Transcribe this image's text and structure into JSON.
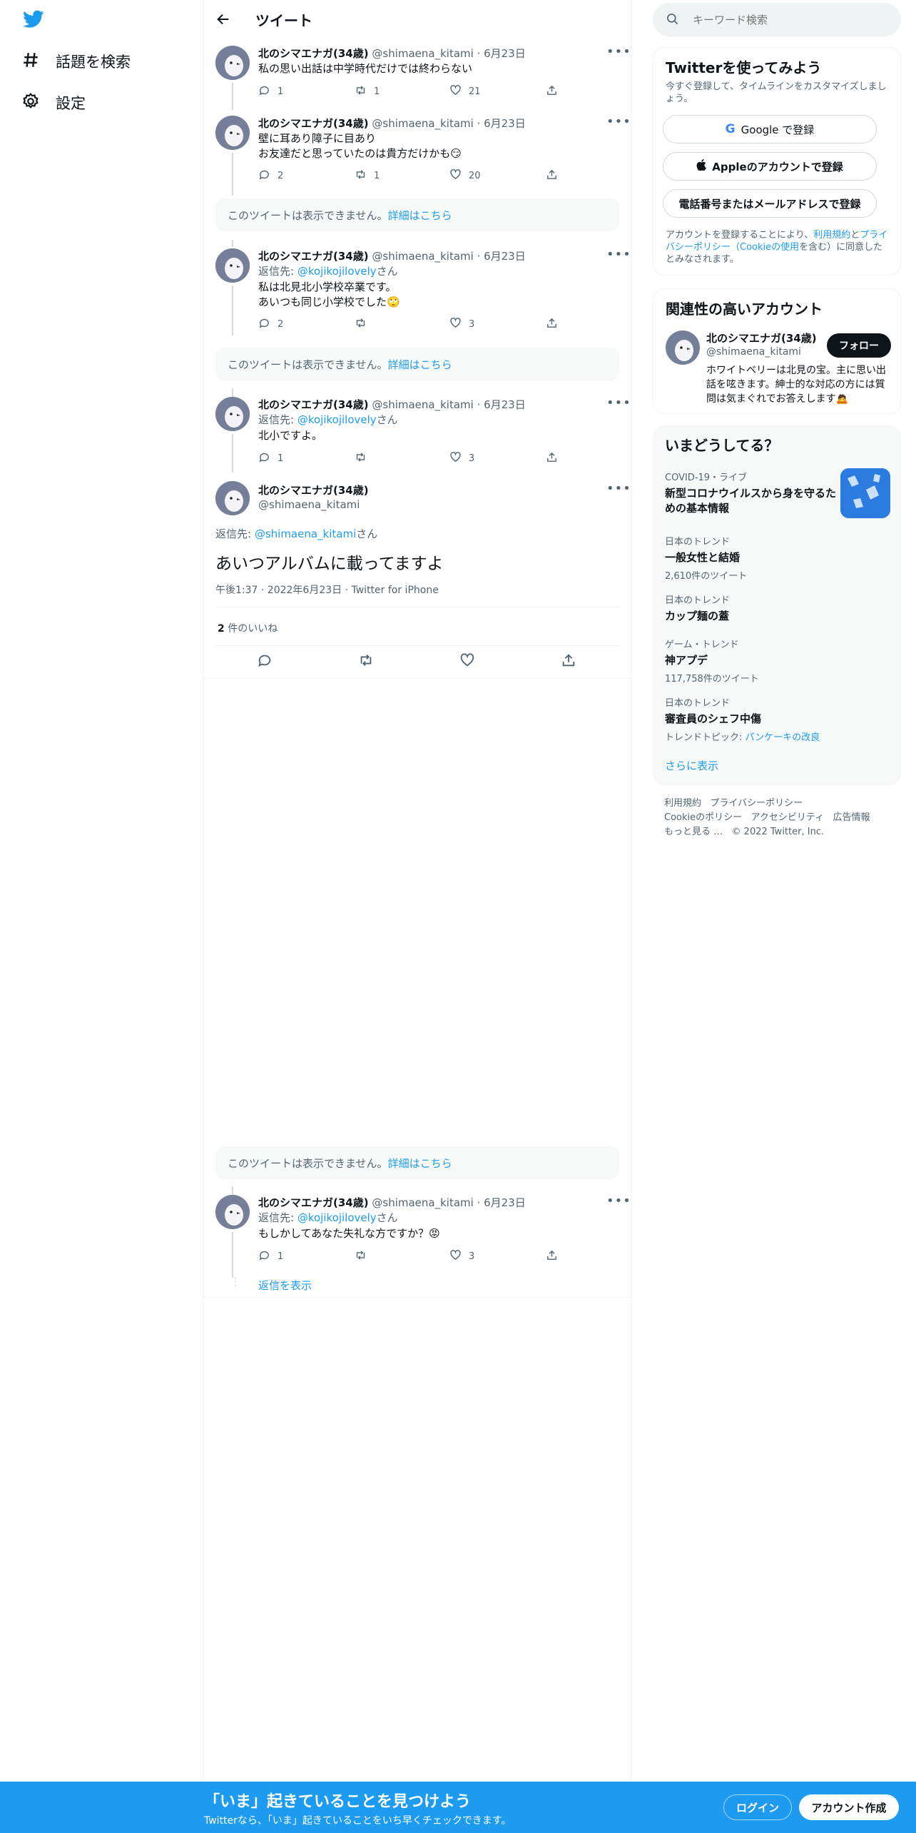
{
  "nav": {
    "explore_label": "話題を検索",
    "settings_label": "設定"
  },
  "header": {
    "title": "ツイート"
  },
  "user": {
    "name": "北のシマエナガ(34歳)",
    "handle": "@shimaena_kitami"
  },
  "tweets": [
    {
      "meta": "@shimaena_kitami · 6月23日",
      "text": "私の思い出話は中学時代だけでは終わらない",
      "replies": "1",
      "retweets": "1",
      "likes": "21"
    },
    {
      "meta": "@shimaena_kitami · 6月23日",
      "text": "壁に耳あり障子に目あり\nお友達だと思っていたのは貴方だけかも😏",
      "replies": "2",
      "retweets": "1",
      "likes": "20"
    },
    {
      "meta": "@shimaena_kitami · 6月23日",
      "reply_prefix": "返信先: ",
      "reply_to": "@kojikojilovely",
      "reply_suffix": "さん",
      "text": "私は北見北小学校卒業です。\nあいつも同じ小学校でした🙄",
      "replies": "2",
      "retweets": "",
      "likes": "3"
    },
    {
      "meta": "@shimaena_kitami · 6月23日",
      "reply_prefix": "返信先: ",
      "reply_to": "@kojikojilovely",
      "reply_suffix": "さん",
      "text": "北小ですよ。",
      "replies": "1",
      "retweets": "",
      "likes": "3"
    },
    {
      "meta": "@shimaena_kitami · 6月23日",
      "reply_prefix": "返信先: ",
      "reply_to": "@kojikojilovely",
      "reply_suffix": "さん",
      "text": "もしかしてあなた失礼な方ですか？😡",
      "replies": "1",
      "retweets": "",
      "likes": "3"
    }
  ],
  "hidden_notice": {
    "text": "このツイートは表示できません。",
    "link": "詳細はこちら"
  },
  "focused": {
    "reply_prefix": "返信先: ",
    "reply_to": "@shimaena_kitami",
    "reply_suffix": "さん",
    "text": "あいつアルバムに載ってますよ",
    "timestamp": "午後1:37 · 2022年6月23日 · Twitter for iPhone",
    "likes_count": "2",
    "likes_label": "件のいいね"
  },
  "show_replies": "返信を表示",
  "search": {
    "placeholder": "キーワード検索"
  },
  "signup": {
    "title": "Twitterを使ってみよう",
    "subtitle": "今すぐ登録して、タイムラインをカスタマイズしましょう。",
    "google": "Google で登録",
    "apple": "Appleのアカウントで登録",
    "phone": "電話番号またはメールアドレスで登録",
    "legal_pre": "アカウントを登録することにより、",
    "legal_terms": "利用規約",
    "legal_and": "と",
    "legal_privacy": "プライバシーポリシー",
    "legal_paren_open": "（",
    "legal_cookie": "Cookieの使用",
    "legal_post": "を含む）に同意したとみなされます。"
  },
  "related": {
    "title": "関連性の高いアカウント",
    "name": "北のシマエナガ(34歳)",
    "handle": "@shimaena_kitami",
    "follow": "フォロー",
    "bio": "ホワイトベリーは北見の宝。主に思い出話を呟きます。紳士的な対応の方には質問は気まぐれでお答えします🙇"
  },
  "trends": {
    "title": "いまどうしてる？",
    "items": [
      {
        "category": "COVID-19・ライブ",
        "title": "新型コロナウイルスから身を守るための基本情報",
        "count": ""
      },
      {
        "category": "日本のトレンド",
        "title": "一般女性と結婚",
        "count": "2,610件のツイート"
      },
      {
        "category": "日本のトレンド",
        "title": "カップ麺の蓋",
        "count": ""
      },
      {
        "category": "ゲーム・トレンド",
        "title": "神アプデ",
        "count": "117,758件のツイート"
      },
      {
        "category": "日本のトレンド",
        "title": "審査員のシェフ中傷",
        "count": ""
      }
    ],
    "topic_prefix": "トレンドトピック: ",
    "topic_link": "パンケーキの改良",
    "show_more": "さらに表示"
  },
  "footer": {
    "terms": "利用規約",
    "privacy": "プライバシーポリシー",
    "cookie": "Cookieのポリシー",
    "accessibility": "アクセシビリティ",
    "ads": "広告情報",
    "more": "もっと見る …",
    "copyright": "© 2022 Twitter, Inc."
  },
  "banner": {
    "title": "「いま」起きていることを見つけよう",
    "subtitle": "Twitterなら、「いま」起きていることをいち早くチェックできます。",
    "login": "ログイン",
    "signup": "アカウント作成"
  },
  "colors": {
    "accent": "#1d9bf0",
    "text": "#0f1419",
    "muted": "#536471",
    "banner": "#1d9bf0"
  }
}
